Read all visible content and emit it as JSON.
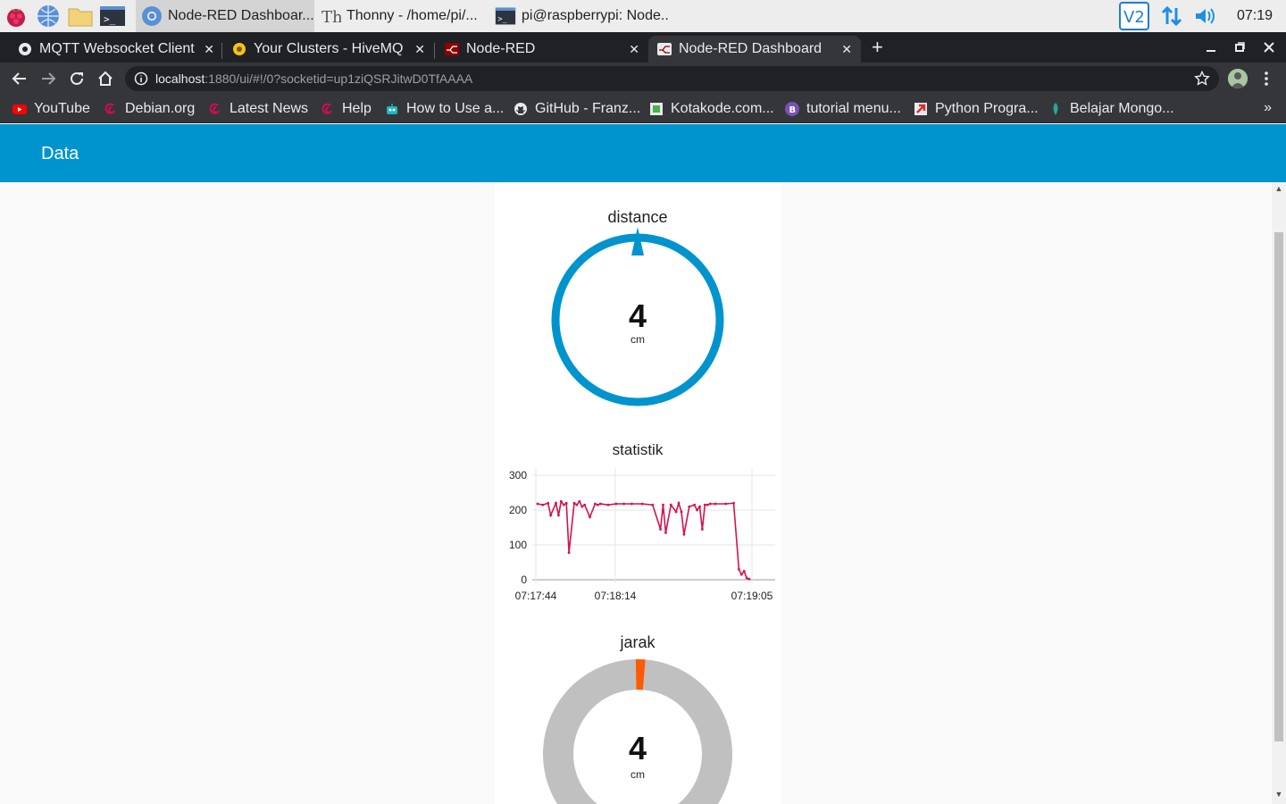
{
  "taskbar": {
    "tasks": [
      {
        "label": "Node-RED Dashboar..."
      },
      {
        "label": "Thonny  -  /home/pi/..."
      },
      {
        "label": "pi@raspberrypi: Node..."
      }
    ],
    "clock": "07:19"
  },
  "browser": {
    "tabs": [
      {
        "title": "MQTT Websocket Client"
      },
      {
        "title": "Your Clusters - HiveMQ C"
      },
      {
        "title": "Node-RED"
      },
      {
        "title": "Node-RED Dashboard"
      }
    ],
    "url_host": "localhost",
    "url_path": ":1880/ui/#!/0?socketid=up1ziQSRJitwD0TfAAAA",
    "bookmarks": [
      {
        "label": "YouTube"
      },
      {
        "label": "Debian.org"
      },
      {
        "label": "Latest News"
      },
      {
        "label": "Help"
      },
      {
        "label": "How to Use a..."
      },
      {
        "label": "GitHub - Franz..."
      },
      {
        "label": "Kotakode.com..."
      },
      {
        "label": "tutorial menu..."
      },
      {
        "label": "Python Progra..."
      },
      {
        "label": "Belajar Mongo..."
      }
    ],
    "bookmarks_more": "»"
  },
  "dashboard": {
    "title": "Data",
    "gauge_distance": {
      "label": "distance",
      "value": "4",
      "units": "cm",
      "fraction": 0.013
    },
    "chart_title": "statistik",
    "gauge_jarak": {
      "label": "jarak",
      "value": "4",
      "units": "cm",
      "fraction": 0.013
    }
  },
  "colors": {
    "header": "#0094ce",
    "gauge_ring": "#0094ce",
    "line": "#d3134f",
    "donut_bg": "#c0c0c0",
    "donut_fill": "#ff5a00"
  },
  "chart_data": {
    "type": "line",
    "title": "statistik",
    "ylim": [
      0,
      300
    ],
    "yticks": [
      "300",
      "200",
      "100",
      "0"
    ],
    "xticks": [
      "07:17:44",
      "07:18:14",
      "07:19:05"
    ],
    "xlabel": "",
    "ylabel": "",
    "grid": true,
    "series": [
      {
        "x_seconds": [
          0,
          2,
          4,
          5,
          7,
          8,
          9,
          10,
          11,
          12,
          14,
          15,
          16,
          17,
          18,
          20,
          22,
          23,
          24,
          27,
          30,
          33,
          36,
          40,
          44,
          47,
          48,
          49,
          51,
          53,
          54,
          55,
          56,
          58,
          60,
          61,
          62,
          63,
          64,
          65,
          66,
          68,
          72,
          75,
          77,
          78,
          79,
          80,
          81
        ],
        "y": [
          218,
          215,
          220,
          185,
          220,
          185,
          225,
          215,
          220,
          78,
          220,
          215,
          225,
          210,
          215,
          180,
          218,
          215,
          218,
          215,
          218,
          218,
          218,
          218,
          215,
          145,
          215,
          135,
          215,
          195,
          220,
          195,
          130,
          210,
          215,
          200,
          210,
          145,
          215,
          215,
          218,
          218,
          218,
          220,
          30,
          15,
          25,
          5,
          2
        ]
      }
    ]
  }
}
